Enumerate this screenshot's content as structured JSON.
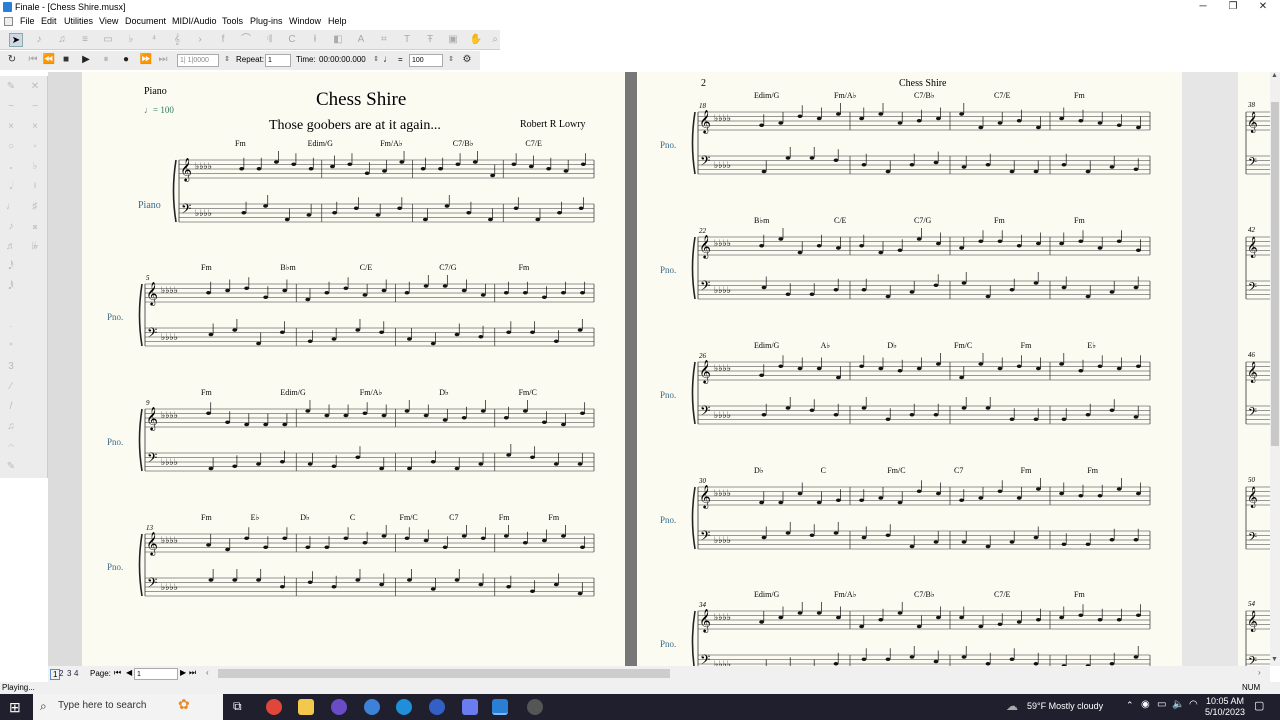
{
  "window": {
    "title": "Finale - [Chess Shire.musx]",
    "controls": [
      "─",
      "❐",
      "✕"
    ]
  },
  "menu": [
    "File",
    "Edit",
    "Utilities",
    "View",
    "Document",
    "MIDI/Audio",
    "Tools",
    "Plug-ins",
    "Window",
    "Help"
  ],
  "playback": {
    "counter": "1| 1|0000",
    "repeat_label": "Repeat:",
    "repeat_value": "1",
    "time_label": "Time:",
    "time_value": "00:00:00.000",
    "tempo_eq": "=",
    "tempo_value": "100"
  },
  "score": {
    "title": "Chess Shire",
    "subtitle": "Those goobers are at it again...",
    "composer": "Robert R Lowry",
    "instrument": "Piano",
    "instrument_full": "Piano",
    "instrument_abbr": "Pno.",
    "tempo_mark": "= 100",
    "page2_number": "2",
    "page2_header": "Chess Shire",
    "page1_systems": [
      {
        "measure": "",
        "chords": [
          "Fm",
          "Edim/G",
          "Fm/A♭",
          "C7/B♭",
          "C7/E"
        ]
      },
      {
        "measure": "5",
        "chords": [
          "Fm",
          "B♭m",
          "C/E",
          "C7/G",
          "Fm"
        ]
      },
      {
        "measure": "9",
        "chords": [
          "Fm",
          "Edim/G",
          "Fm/A♭",
          "D♭",
          "Fm/C"
        ]
      },
      {
        "measure": "13",
        "chords": [
          "Fm",
          "E♭",
          "D♭",
          "C",
          "Fm/C",
          "C7",
          "Fm",
          "Fm"
        ]
      }
    ],
    "page2_systems": [
      {
        "measure": "18",
        "chords": [
          "Edim/G",
          "Fm/A♭",
          "C7/B♭",
          "C7/E",
          "Fm"
        ]
      },
      {
        "measure": "22",
        "chords": [
          "B♭m",
          "C/E",
          "C7/G",
          "Fm",
          "Fm"
        ]
      },
      {
        "measure": "26",
        "chords": [
          "Edim/G",
          "A♭",
          "D♭",
          "Fm/C",
          "Fm",
          "E♭"
        ]
      },
      {
        "measure": "30",
        "chords": [
          "D♭",
          "C",
          "Fm/C",
          "C7",
          "Fm",
          "Fm"
        ]
      },
      {
        "measure": "34",
        "chords": [
          "Edim/G",
          "Fm/A♭",
          "C7/B♭",
          "C7/E",
          "Fm"
        ]
      }
    ],
    "page3_measures": [
      "38",
      "42",
      "46",
      "50",
      "54"
    ]
  },
  "bottom": {
    "pages": [
      "1",
      "2",
      "3",
      "4"
    ],
    "page_label": "Page:",
    "page_value": "1"
  },
  "status": {
    "left": "Playing...",
    "right": "NUM"
  },
  "taskbar": {
    "search_placeholder": "Type here to search",
    "weather": "59°F  Mostly cloudy",
    "time": "10:05 AM",
    "date": "5/10/2023"
  },
  "colors": {
    "paper": "#fbfbf2",
    "instrument_label": "#3a6b8a",
    "taskbar": "#1f1f2e"
  }
}
